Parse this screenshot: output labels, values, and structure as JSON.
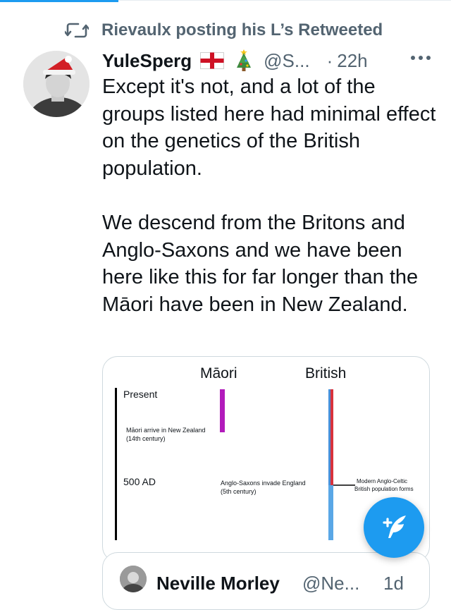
{
  "retweet": {
    "label": "Rievaulx posting his L’s Retweeted",
    "icon": "retweet-icon"
  },
  "tweet": {
    "author_name": "YuleSperg",
    "author_emoji": [
      "england-flag-icon",
      "christmas-tree-icon"
    ],
    "handle": "@S...",
    "separator": "·",
    "time": "22h",
    "more_icon": "more-icon",
    "text": "Except it's not, and a lot of the groups listed here had minimal effect on the genetics of the British population.\n\nWe descend from the Britons and Anglo-Saxons and we have been here like this for far longer than the Māori have been in New Zealand."
  },
  "media": {
    "col_maori": "Māori",
    "col_british": "British",
    "label_present": "Present",
    "label_maori_arrive_1": "Māori arrive in New Zealand",
    "label_maori_arrive_2": "(14th century)",
    "label_500ad": "500 AD",
    "label_anglo_1": "Anglo-Saxons invade England",
    "label_anglo_2": "(5th century)",
    "label_modern_1": "Modern Anglo-Celtic",
    "label_modern_2": "British population forms",
    "colors": {
      "maori_bar": "#b21bbb",
      "british_upper_red": "#d8323c",
      "british_upper_blue": "#4a90d9",
      "british_lower": "#5aa7e6",
      "axis": "#000000"
    }
  },
  "quote": {
    "name": "Neville Morley",
    "handle": "@Ne...",
    "time": "1d"
  },
  "fab": {
    "icon": "compose-tweet-icon",
    "color": "#1d9bf0"
  }
}
